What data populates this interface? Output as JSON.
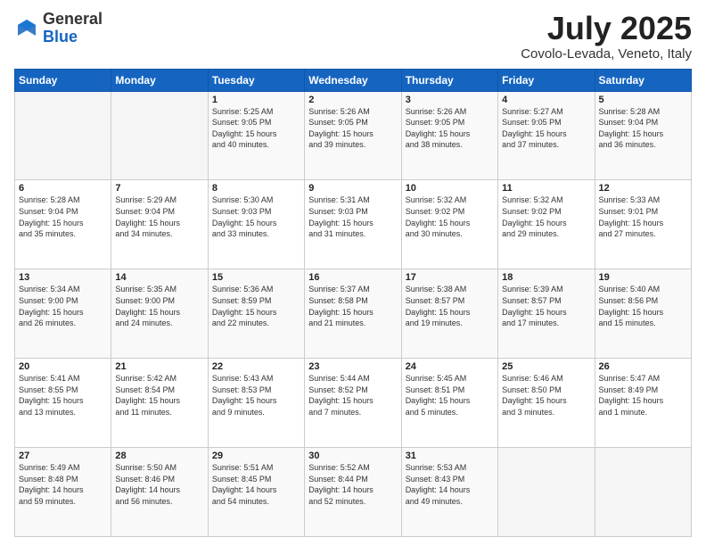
{
  "header": {
    "logo_general": "General",
    "logo_blue": "Blue",
    "month_title": "July 2025",
    "location": "Covolo-Levada, Veneto, Italy"
  },
  "days_of_week": [
    "Sunday",
    "Monday",
    "Tuesday",
    "Wednesday",
    "Thursday",
    "Friday",
    "Saturday"
  ],
  "weeks": [
    [
      {
        "day": "",
        "info": ""
      },
      {
        "day": "",
        "info": ""
      },
      {
        "day": "1",
        "info": "Sunrise: 5:25 AM\nSunset: 9:05 PM\nDaylight: 15 hours\nand 40 minutes."
      },
      {
        "day": "2",
        "info": "Sunrise: 5:26 AM\nSunset: 9:05 PM\nDaylight: 15 hours\nand 39 minutes."
      },
      {
        "day": "3",
        "info": "Sunrise: 5:26 AM\nSunset: 9:05 PM\nDaylight: 15 hours\nand 38 minutes."
      },
      {
        "day": "4",
        "info": "Sunrise: 5:27 AM\nSunset: 9:05 PM\nDaylight: 15 hours\nand 37 minutes."
      },
      {
        "day": "5",
        "info": "Sunrise: 5:28 AM\nSunset: 9:04 PM\nDaylight: 15 hours\nand 36 minutes."
      }
    ],
    [
      {
        "day": "6",
        "info": "Sunrise: 5:28 AM\nSunset: 9:04 PM\nDaylight: 15 hours\nand 35 minutes."
      },
      {
        "day": "7",
        "info": "Sunrise: 5:29 AM\nSunset: 9:04 PM\nDaylight: 15 hours\nand 34 minutes."
      },
      {
        "day": "8",
        "info": "Sunrise: 5:30 AM\nSunset: 9:03 PM\nDaylight: 15 hours\nand 33 minutes."
      },
      {
        "day": "9",
        "info": "Sunrise: 5:31 AM\nSunset: 9:03 PM\nDaylight: 15 hours\nand 31 minutes."
      },
      {
        "day": "10",
        "info": "Sunrise: 5:32 AM\nSunset: 9:02 PM\nDaylight: 15 hours\nand 30 minutes."
      },
      {
        "day": "11",
        "info": "Sunrise: 5:32 AM\nSunset: 9:02 PM\nDaylight: 15 hours\nand 29 minutes."
      },
      {
        "day": "12",
        "info": "Sunrise: 5:33 AM\nSunset: 9:01 PM\nDaylight: 15 hours\nand 27 minutes."
      }
    ],
    [
      {
        "day": "13",
        "info": "Sunrise: 5:34 AM\nSunset: 9:00 PM\nDaylight: 15 hours\nand 26 minutes."
      },
      {
        "day": "14",
        "info": "Sunrise: 5:35 AM\nSunset: 9:00 PM\nDaylight: 15 hours\nand 24 minutes."
      },
      {
        "day": "15",
        "info": "Sunrise: 5:36 AM\nSunset: 8:59 PM\nDaylight: 15 hours\nand 22 minutes."
      },
      {
        "day": "16",
        "info": "Sunrise: 5:37 AM\nSunset: 8:58 PM\nDaylight: 15 hours\nand 21 minutes."
      },
      {
        "day": "17",
        "info": "Sunrise: 5:38 AM\nSunset: 8:57 PM\nDaylight: 15 hours\nand 19 minutes."
      },
      {
        "day": "18",
        "info": "Sunrise: 5:39 AM\nSunset: 8:57 PM\nDaylight: 15 hours\nand 17 minutes."
      },
      {
        "day": "19",
        "info": "Sunrise: 5:40 AM\nSunset: 8:56 PM\nDaylight: 15 hours\nand 15 minutes."
      }
    ],
    [
      {
        "day": "20",
        "info": "Sunrise: 5:41 AM\nSunset: 8:55 PM\nDaylight: 15 hours\nand 13 minutes."
      },
      {
        "day": "21",
        "info": "Sunrise: 5:42 AM\nSunset: 8:54 PM\nDaylight: 15 hours\nand 11 minutes."
      },
      {
        "day": "22",
        "info": "Sunrise: 5:43 AM\nSunset: 8:53 PM\nDaylight: 15 hours\nand 9 minutes."
      },
      {
        "day": "23",
        "info": "Sunrise: 5:44 AM\nSunset: 8:52 PM\nDaylight: 15 hours\nand 7 minutes."
      },
      {
        "day": "24",
        "info": "Sunrise: 5:45 AM\nSunset: 8:51 PM\nDaylight: 15 hours\nand 5 minutes."
      },
      {
        "day": "25",
        "info": "Sunrise: 5:46 AM\nSunset: 8:50 PM\nDaylight: 15 hours\nand 3 minutes."
      },
      {
        "day": "26",
        "info": "Sunrise: 5:47 AM\nSunset: 8:49 PM\nDaylight: 15 hours\nand 1 minute."
      }
    ],
    [
      {
        "day": "27",
        "info": "Sunrise: 5:49 AM\nSunset: 8:48 PM\nDaylight: 14 hours\nand 59 minutes."
      },
      {
        "day": "28",
        "info": "Sunrise: 5:50 AM\nSunset: 8:46 PM\nDaylight: 14 hours\nand 56 minutes."
      },
      {
        "day": "29",
        "info": "Sunrise: 5:51 AM\nSunset: 8:45 PM\nDaylight: 14 hours\nand 54 minutes."
      },
      {
        "day": "30",
        "info": "Sunrise: 5:52 AM\nSunset: 8:44 PM\nDaylight: 14 hours\nand 52 minutes."
      },
      {
        "day": "31",
        "info": "Sunrise: 5:53 AM\nSunset: 8:43 PM\nDaylight: 14 hours\nand 49 minutes."
      },
      {
        "day": "",
        "info": ""
      },
      {
        "day": "",
        "info": ""
      }
    ]
  ]
}
